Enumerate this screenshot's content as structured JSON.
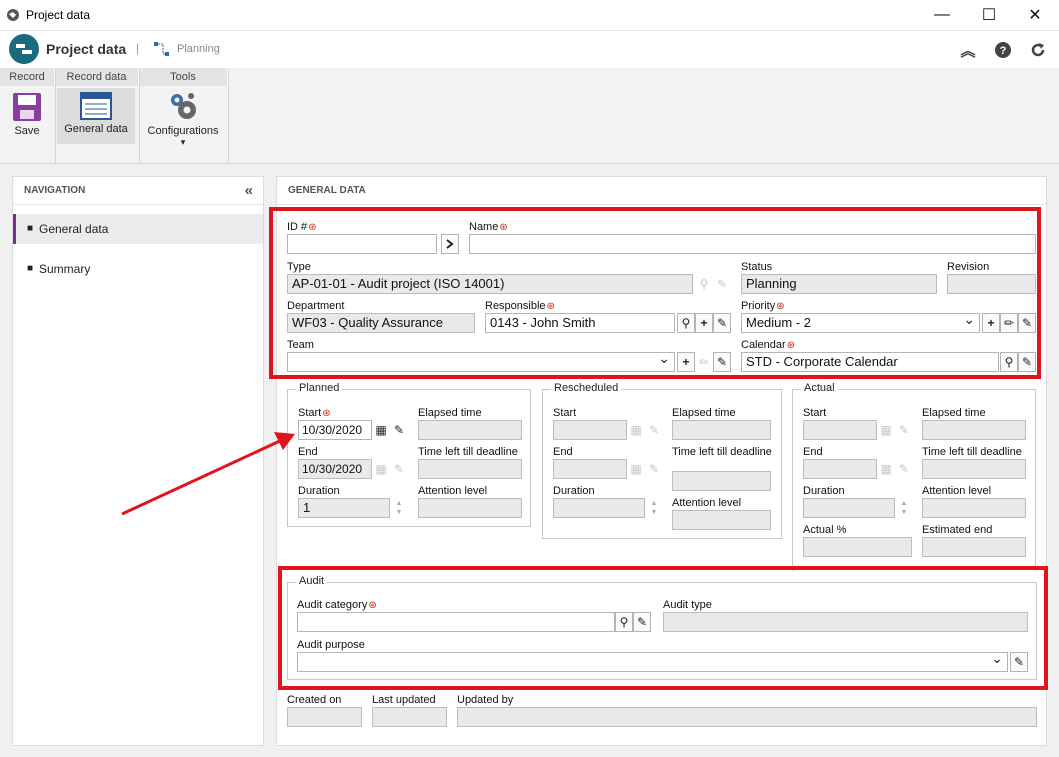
{
  "window": {
    "title": "Project data",
    "minimize": "—",
    "maximize": "☐",
    "close": "✕"
  },
  "appbar": {
    "title": "Project data",
    "separator": "|",
    "breadcrumb": "Planning"
  },
  "ribbon": {
    "groups": [
      "Record",
      "Record data",
      "Tools"
    ],
    "buttons": {
      "save": "Save",
      "general_data": "General data",
      "configurations": "Configurations",
      "dropdown_arrow": "▾"
    }
  },
  "navigation": {
    "title": "NAVIGATION",
    "collapse": "«",
    "items": [
      {
        "label": "General data",
        "active": true
      },
      {
        "label": "Summary",
        "active": false
      }
    ]
  },
  "main": {
    "title": "GENERAL DATA"
  },
  "form": {
    "id_label": "ID #",
    "id_value": "",
    "name_label": "Name",
    "name_value": "",
    "type_label": "Type",
    "type_value": "AP-01-01 - Audit project (ISO 14001)",
    "status_label": "Status",
    "status_value": "Planning",
    "revision_label": "Revision",
    "revision_value": "",
    "department_label": "Department",
    "department_value": "WF03 - Quality Assurance",
    "responsible_label": "Responsible",
    "responsible_value": "0143 - John Smith",
    "priority_label": "Priority",
    "priority_value": "Medium - 2",
    "team_label": "Team",
    "team_value": "",
    "calendar_label": "Calendar",
    "calendar_value": "STD - Corporate Calendar"
  },
  "planned": {
    "legend": "Planned",
    "start": "Start",
    "start_value": "10/30/2020",
    "end": "End",
    "end_value": "10/30/2020",
    "duration": "Duration",
    "duration_value": "1",
    "elapsed": "Elapsed time",
    "time_left": "Time left till deadline",
    "attention": "Attention level"
  },
  "rescheduled": {
    "legend": "Rescheduled",
    "start": "Start",
    "end": "End",
    "duration": "Duration",
    "elapsed": "Elapsed time",
    "time_left": "Time left till deadline",
    "attention": "Attention level"
  },
  "actual": {
    "legend": "Actual",
    "start": "Start",
    "end": "End",
    "duration": "Duration",
    "elapsed": "Elapsed time",
    "time_left": "Time left till deadline",
    "attention": "Attention level",
    "actual_pct": "Actual %",
    "estimated_end": "Estimated end"
  },
  "audit": {
    "legend": "Audit",
    "category_label": "Audit category",
    "category_value": "",
    "type_label": "Audit type",
    "type_value": "",
    "purpose_label": "Audit purpose",
    "purpose_value": ""
  },
  "footer": {
    "created_on": "Created on",
    "last_updated": "Last updated",
    "updated_by": "Updated by"
  },
  "colors": {
    "highlight": "#e0141c",
    "nav_active": "#7b2d8e",
    "logo": "#1a6b80"
  }
}
